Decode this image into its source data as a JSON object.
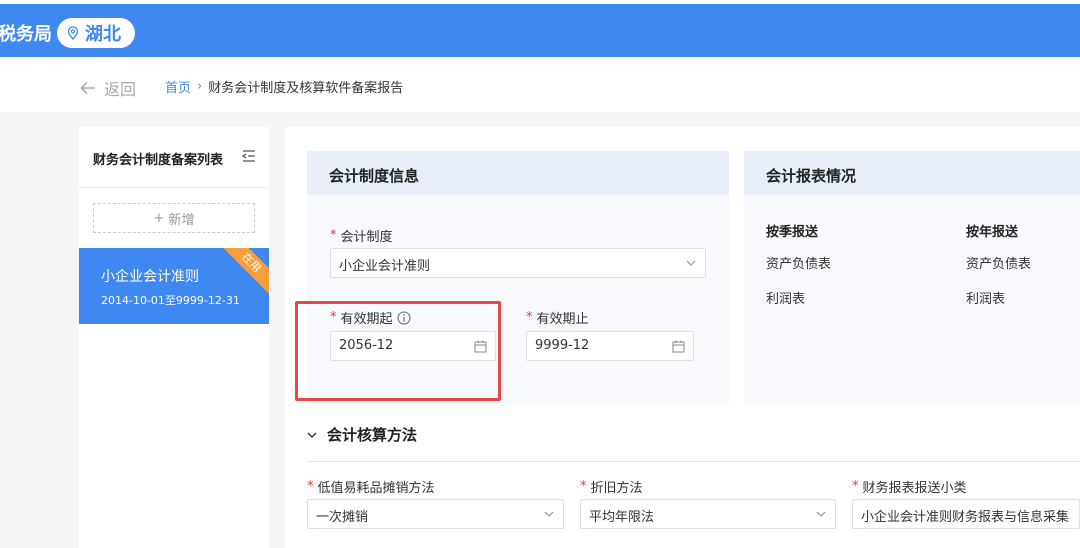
{
  "header": {
    "bureau_suffix": "税务局",
    "region": "湖北"
  },
  "nav": {
    "back_label": "返回",
    "breadcrumb_home": "首页",
    "breadcrumb_sep": "›",
    "breadcrumb_current": "财务会计制度及核算软件备案报告"
  },
  "sidebar": {
    "title": "财务会计制度备案列表",
    "add_label": "新增",
    "items": [
      {
        "name": "小企业会计准则",
        "range": "2014-10-01至9999-12-31",
        "badge": "在用"
      }
    ]
  },
  "policy_panel": {
    "title": "会计制度信息",
    "system_label": "会计制度",
    "system_value": "小企业会计准则",
    "start_label": "有效期起",
    "start_value": "2056-12",
    "end_label": "有效期止",
    "end_value": "9999-12"
  },
  "report_panel": {
    "title": "会计报表情况",
    "columns": [
      {
        "header": "按季报送",
        "items": [
          "资产负债表",
          "利润表"
        ]
      },
      {
        "header": "按年报送",
        "items": [
          "资产负债表",
          "利润表"
        ]
      }
    ]
  },
  "accounting_section": {
    "title": "会计核算方法",
    "fields": [
      {
        "label": "低值易耗品摊销方法",
        "value": "一次摊销"
      },
      {
        "label": "折旧方法",
        "value": "平均年限法"
      },
      {
        "label": "财务报表报送小类",
        "value": "小企业会计准则财务报表与信息采集"
      }
    ]
  },
  "colors": {
    "primary": "#3f88f1",
    "highlight": "#e8474a",
    "badge": "#f5a03c"
  }
}
